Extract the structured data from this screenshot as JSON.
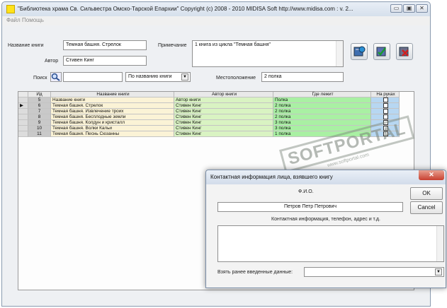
{
  "window": {
    "title": "\"Библиотека храма Св. Сильвестра Омско-Тарской Епархии\" Copyright (c) 2008 - 2010 MIDISA Soft http://www.midisa.com : v. 2...",
    "controls": [
      "▭",
      "▣",
      "✕"
    ]
  },
  "menu": {
    "items": [
      "Файл",
      "Помощь"
    ]
  },
  "form": {
    "book_title_label": "Название книги",
    "book_title_value": "Темная башня. Стрелок",
    "author_label": "Автор",
    "author_value": "Стивен Кинг",
    "note_label": "Примечание",
    "note_value": "1 книга из цикла \"Темная башня\"",
    "search_label": "Поиск",
    "search_value": "",
    "search_mode": "По названию книги",
    "location_label": "Местоположение",
    "location_value": "2 полка"
  },
  "toolbar": {
    "buttons": [
      "add-book-icon",
      "edit-book-icon",
      "delete-book-icon"
    ]
  },
  "table": {
    "headers": {
      "id": "Ид",
      "title": "Название книги",
      "author": "Автор книги",
      "place": "Где лежит",
      "hands": "На руках"
    },
    "current_row_marker": "▶",
    "rows": [
      {
        "id": "5",
        "title": "Название книги",
        "author": "Автор книги",
        "place": "Полка"
      },
      {
        "id": "6",
        "title": "Темная башня. Стрелок",
        "author": "Стивен Кинг",
        "place": "2 полка"
      },
      {
        "id": "7",
        "title": "Темная башня. Извлечение троих",
        "author": "Стивен Кинг",
        "place": "2 полка"
      },
      {
        "id": "8",
        "title": "Темная башня. Бесплодные земли",
        "author": "Стивен Кинг",
        "place": "2 полка"
      },
      {
        "id": "9",
        "title": "Темная башня. Колдун и кристалл",
        "author": "Стивен Кинг",
        "place": "3 полка"
      },
      {
        "id": "10",
        "title": "Темная башня. Волки Кальи",
        "author": "Стивен Кинг",
        "place": "3 полка"
      },
      {
        "id": "11",
        "title": "Темная башня. Песнь Сюзанны",
        "author": "Стивен Кинг",
        "place": "1 полка"
      }
    ]
  },
  "watermark": {
    "main": "SOFTPORTAL",
    "sub": "www.softportal.com"
  },
  "dialog": {
    "title": "Контактная информация лица, взявшего книгу",
    "fio_label": "Ф.И.О.",
    "fio_value": "Петров Петр Петрович",
    "ok_label": "OK",
    "cancel_label": "Cancel",
    "contact_label": "Контактная информация, телефон, адрес и т.д.",
    "contact_value": "",
    "prev_data_label": "Взять ранее введенные данные:",
    "prev_data_value": ""
  },
  "colors": {
    "title_col": "#fbf3d6",
    "author_col": "#d9f3c2",
    "place_col": "#a9f0a3",
    "hands_col": "#b7d7f2",
    "app_icon": "#ffe21a"
  }
}
